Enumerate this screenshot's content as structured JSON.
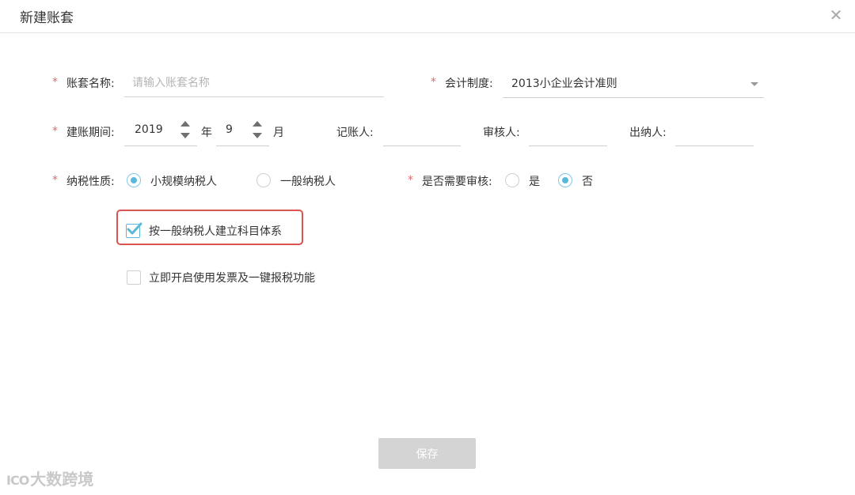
{
  "dialog": {
    "title": "新建账套",
    "close_icon": "close-icon"
  },
  "form": {
    "required_mark": "*",
    "account_name": {
      "label": "账套名称:",
      "placeholder": "请输入账套名称",
      "value": ""
    },
    "accounting_system": {
      "label": "会计制度:",
      "value": "2013小企业会计准则"
    },
    "period": {
      "label": "建账期间:",
      "year": "2019",
      "year_unit": "年",
      "month": "9",
      "month_unit": "月"
    },
    "bookkeeper": {
      "label": "记账人:"
    },
    "reviewer": {
      "label": "审核人:"
    },
    "cashier": {
      "label": "出纳人:"
    },
    "taxpayer_type": {
      "label": "纳税性质:",
      "options": [
        {
          "label": "小规模纳税人",
          "selected": true
        },
        {
          "label": "一般纳税人",
          "selected": false
        }
      ]
    },
    "need_review": {
      "label": "是否需要审核:",
      "options": [
        {
          "label": "是",
          "selected": false
        },
        {
          "label": "否",
          "selected": true
        }
      ]
    },
    "general_subjects": {
      "label": "按一般纳税人建立科目体系",
      "checked": true
    },
    "invoice_feature": {
      "label": "立即开启使用发票及一键报税功能",
      "checked": false
    }
  },
  "footer": {
    "save_label": "保存"
  },
  "watermark": {
    "logo": "ICO",
    "text": "大数跨境"
  },
  "colors": {
    "accent": "#5ab8d9",
    "required": "#e06a6a",
    "highlight": "#d9534f",
    "disabled_button": "#d4d4d4"
  }
}
